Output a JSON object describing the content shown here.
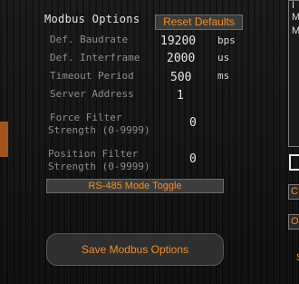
{
  "panel": {
    "title": "Modbus Options",
    "reset_label": "Reset Defaults",
    "fields": [
      {
        "label": "Def. Baudrate",
        "value": "19200",
        "unit": "bps"
      },
      {
        "label": "Def. Interframe",
        "value": "2000",
        "unit": "us"
      },
      {
        "label": "Timeout Period",
        "value": "500",
        "unit": "ms"
      },
      {
        "label": "Server Address",
        "value": "1",
        "unit": ""
      }
    ],
    "force_filter": {
      "label_line1": "Force Filter",
      "label_line2": "Strength (0-9999)",
      "value": "0"
    },
    "position_filter": {
      "label_line1": "Position Filter",
      "label_line2": "Strength (0-9999)",
      "value": "0"
    },
    "rs485_label": "RS-485 Mode Toggle",
    "save_label": "Save Modbus Options"
  },
  "side": {
    "panel_lines": [
      "I",
      "M",
      "M"
    ],
    "button1_text": "C",
    "button2_text": "O",
    "bottom_text": "S"
  },
  "colors": {
    "accent": "#f08c28",
    "left_accent": "#a4531c"
  }
}
